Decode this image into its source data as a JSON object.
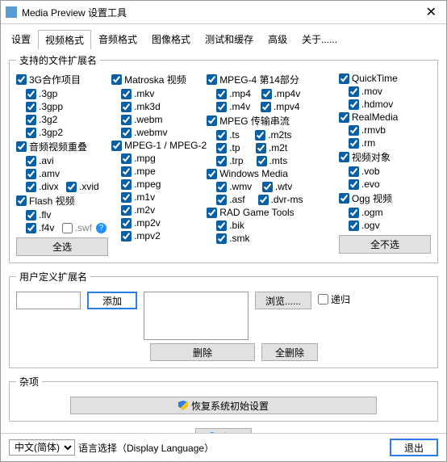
{
  "title": "Media Preview 设置工具",
  "close": "✕",
  "tabs": [
    "设置",
    "视频格式",
    "音频格式",
    "图像格式",
    "测试和缓存",
    "高级",
    "关于......"
  ],
  "activeTab": 1,
  "supported": {
    "legend": "支持的文件扩展名",
    "col1": {
      "g3": "3G合作项目",
      "g3items": [
        ".3gp",
        ".3gpp",
        ".3g2",
        ".3gp2"
      ],
      "av": "音频视频重叠",
      "avitems": [
        ".avi",
        ".amv",
        ".divx",
        ".xvid"
      ],
      "fl": "Flash 视频",
      "flitems": [
        ".flv",
        ".f4v",
        ".swf"
      ]
    },
    "col2": {
      "mk": "Matroska 视频",
      "mkitems": [
        ".mkv",
        ".mk3d",
        ".webm",
        ".webmv"
      ],
      "mp": "MPEG-1 / MPEG-2",
      "mpitems": [
        ".mpg",
        ".mpe",
        ".mpeg",
        ".m1v",
        ".m2v",
        ".mp2v",
        ".mpv2"
      ]
    },
    "col3": {
      "m4": "MPEG-4 第14部分",
      "m4a": [
        ".mp4",
        ".mp4v"
      ],
      "m4b": [
        ".m4v",
        ".mpv4"
      ],
      "ts": "MPEG 传输串流",
      "tsa": [
        ".ts",
        ".m2ts"
      ],
      "tsb": [
        ".tp",
        ".m2t"
      ],
      "tsc": [
        ".trp",
        ".mts"
      ],
      "wm": "Windows Media",
      "wma": [
        ".wmv",
        ".wtv"
      ],
      "wmb": [
        ".asf",
        ".dvr-ms"
      ],
      "rg": "RAD Game Tools",
      "rgitems": [
        ".bik",
        ".smk"
      ]
    },
    "col4": {
      "qt": "QuickTime",
      "qtitems": [
        ".mov",
        ".hdmov"
      ],
      "rm": "RealMedia",
      "rmitems": [
        ".rmvb",
        ".rm"
      ],
      "vo": "视频对象",
      "voitems": [
        ".vob",
        ".evo"
      ],
      "og": "Ogg 视频",
      "ogitems": [
        ".ogm",
        ".ogv"
      ]
    },
    "selectAll": "全选",
    "deselectAll": "全不选"
  },
  "user": {
    "legend": "用户定义扩展名",
    "add": "添加",
    "browse": "浏览......",
    "recurse": "递归",
    "del": "删除",
    "delAll": "全删除"
  },
  "misc": {
    "legend": "杂项",
    "restore": "恢复系统初始设置"
  },
  "apply": "应用",
  "footer": {
    "langs": [
      "中文(简体)"
    ],
    "langLabel": "语言选择（Display Language）",
    "exit": "退出"
  }
}
